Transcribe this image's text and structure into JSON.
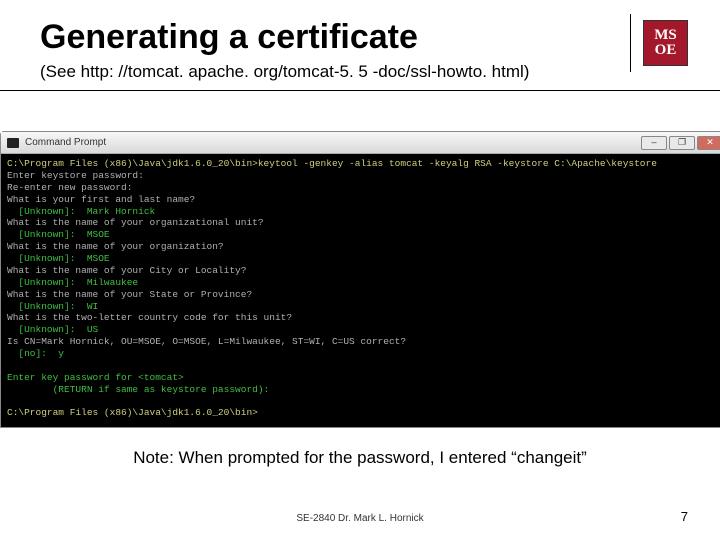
{
  "header": {
    "title": "Generating a certificate",
    "subtitle": "(See http: //tomcat. apache. org/tomcat-5. 5 -doc/ssl-howto. html)",
    "logo_line1": "MS",
    "logo_line2": "OE"
  },
  "window": {
    "title": "Command Prompt",
    "min": "–",
    "max": "❐",
    "close": "✕"
  },
  "terminal": {
    "l1": "C:\\Program Files (x86)\\Java\\jdk1.6.0_20\\bin>keytool -genkey -alias tomcat -keyalg RSA -keystore C:\\Apache\\keystore",
    "l2": "Enter keystore password:",
    "l3": "Re-enter new password:",
    "l4": "What is your first and last name?",
    "l5": "  [Unknown]:  Mark Hornick",
    "l6": "What is the name of your organizational unit?",
    "l7": "  [Unknown]:  MSOE",
    "l8": "What is the name of your organization?",
    "l9": "  [Unknown]:  MSOE",
    "l10": "What is the name of your City or Locality?",
    "l11": "  [Unknown]:  Milwaukee",
    "l12": "What is the name of your State or Province?",
    "l13": "  [Unknown]:  WI",
    "l14": "What is the two-letter country code for this unit?",
    "l15": "  [Unknown]:  US",
    "l16": "Is CN=Mark Hornick, OU=MSOE, O=MSOE, L=Milwaukee, ST=WI, C=US correct?",
    "l17": "  [no]:  y",
    "l18": " ",
    "l19": "Enter key password for <tomcat>",
    "l20": "        (RETURN if same as keystore password):",
    "l21": " ",
    "l22": "C:\\Program Files (x86)\\Java\\jdk1.6.0_20\\bin>"
  },
  "note": "Note: When prompted for the password, I entered “changeit”",
  "footer": {
    "center": "SE-2840 Dr. Mark L. Hornick",
    "page": "7"
  }
}
